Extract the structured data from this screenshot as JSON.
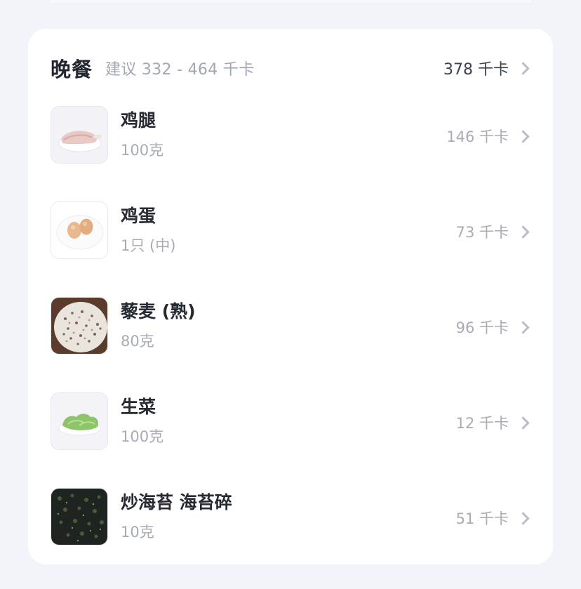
{
  "meal": {
    "title": "晚餐",
    "suggestion": "建议 332 - 464 千卡",
    "total": "378 千卡"
  },
  "foods": [
    {
      "name": "鸡腿",
      "amount": "100克",
      "kcal": "146 千卡",
      "icon": "chicken-leg-icon"
    },
    {
      "name": "鸡蛋",
      "amount": "1只 (中)",
      "kcal": "73 千卡",
      "icon": "eggs-icon"
    },
    {
      "name": "藜麦 (熟)",
      "amount": "80克",
      "kcal": "96 千卡",
      "icon": "quinoa-icon"
    },
    {
      "name": "生菜",
      "amount": "100克",
      "kcal": "12 千卡",
      "icon": "lettuce-icon"
    },
    {
      "name": "炒海苔 海苔碎",
      "amount": "10克",
      "kcal": "51 千卡",
      "icon": "seaweed-icon"
    }
  ]
}
